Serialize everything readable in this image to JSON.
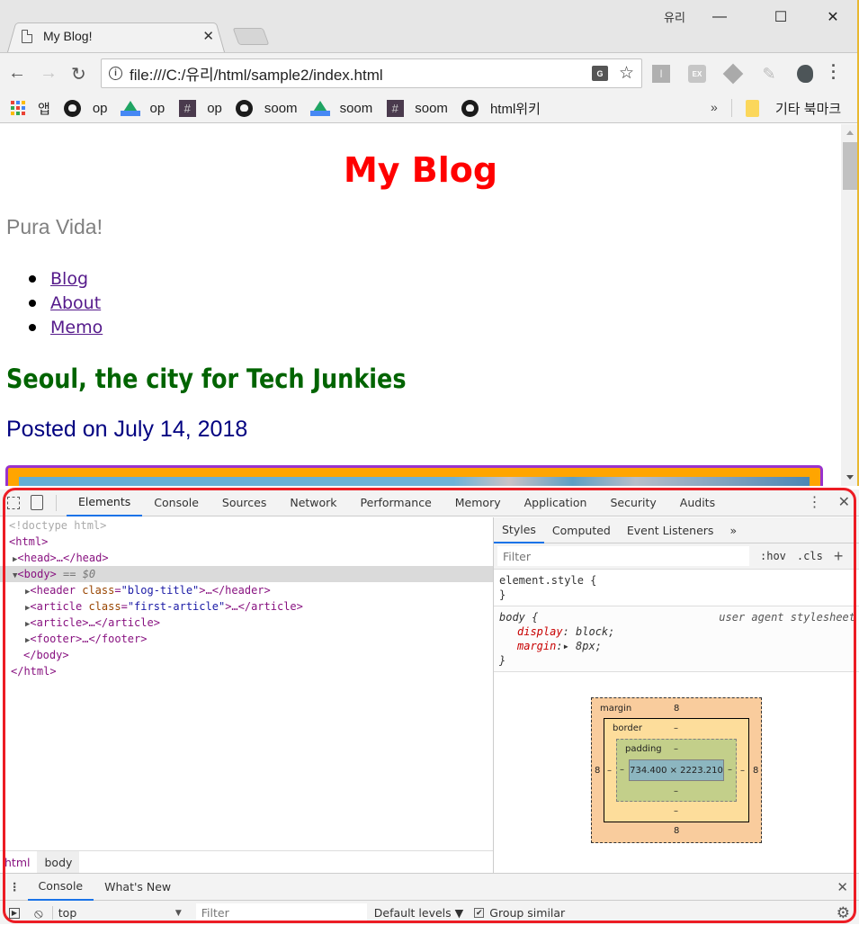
{
  "browser": {
    "tab_title": "My Blog!",
    "user_label": "유리",
    "url": "file:///C:/유리/html/sample2/index.html",
    "bookmarks": [
      {
        "icon": "apps-icon",
        "label": "앱"
      },
      {
        "icon": "github-icon",
        "label": "op"
      },
      {
        "icon": "google-drive-icon",
        "label": "op"
      },
      {
        "icon": "slack-icon",
        "label": "op"
      },
      {
        "icon": "github-icon",
        "label": "soom"
      },
      {
        "icon": "google-drive-icon",
        "label": "soom"
      },
      {
        "icon": "slack-icon",
        "label": "soom"
      },
      {
        "icon": "github-icon",
        "label": "html위키"
      }
    ],
    "bookmarks_more": "»",
    "other_bookmarks": "기타 북마크",
    "extensions": [
      "instapaper-icon",
      "ex-icon",
      "layers-icon",
      "highlighter-icon",
      "evernote-icon"
    ]
  },
  "page": {
    "blog_title": "My Blog",
    "tagline": "Pura Vida!",
    "nav": [
      "Blog",
      "About",
      "Memo"
    ],
    "article_title": "Seoul, the city for Tech Junkies",
    "post_date": "Posted on July 14, 2018",
    "colors": {
      "title": "#ff0000",
      "tagline": "#808080",
      "article_title": "#006400",
      "date": "#000080",
      "frame_bg": "#ffa500",
      "frame_border": "#9932cc"
    }
  },
  "devtools": {
    "tabs": [
      "Elements",
      "Console",
      "Sources",
      "Network",
      "Performance",
      "Memory",
      "Application",
      "Security",
      "Audits"
    ],
    "active_tab": "Elements",
    "dom": {
      "doctype": "<!doctype html>",
      "html_open": "<html>",
      "head": "<head>…</head>",
      "body_open": "<body>",
      "body_marker": "== $0",
      "header_tag": "<header ",
      "header_attr": "class",
      "header_val": "\"blog-title\"",
      "header_close": ">…</header>",
      "article1_tag": "<article ",
      "article1_attr": "class",
      "article1_val": "\"first-article\"",
      "article1_close": ">…</article>",
      "article2": "<article>…</article>",
      "footer": "<footer>…</footer>",
      "body_close": "</body>",
      "html_close": "</html>"
    },
    "breadcrumbs": [
      "html",
      "body"
    ],
    "styles_tabs": [
      "Styles",
      "Computed",
      "Event Listeners",
      "»"
    ],
    "filter_placeholder": "Filter",
    "hov": ":hov",
    "cls": ".cls",
    "rules": {
      "element_style_open": "element.style {",
      "close": "}",
      "body_selector": "body {",
      "body_source": "user agent stylesheet",
      "prop1_name": "display",
      "prop1_value": ": block;",
      "prop2_name": "margin",
      "prop2_value": ":▸ 8px;"
    },
    "box_model": {
      "margin_label": "margin",
      "border_label": "border",
      "padding_label": "padding",
      "margin_top": "8",
      "margin_bottom": "8",
      "margin_left": "8",
      "margin_right": "8",
      "border_top": "–",
      "border_bottom": "–",
      "border_left": "–",
      "border_right": "–",
      "padding_top": "–",
      "padding_bottom": "–",
      "padding_left": "–",
      "padding_right": "–",
      "content": "734.400 × 2223.210"
    },
    "drawer": {
      "tabs": [
        "Console",
        "What's New"
      ],
      "context": "top",
      "filter_placeholder": "Filter",
      "levels": "Default levels ▼",
      "group_similar": "Group similar",
      "group_similar_checked": true
    }
  }
}
